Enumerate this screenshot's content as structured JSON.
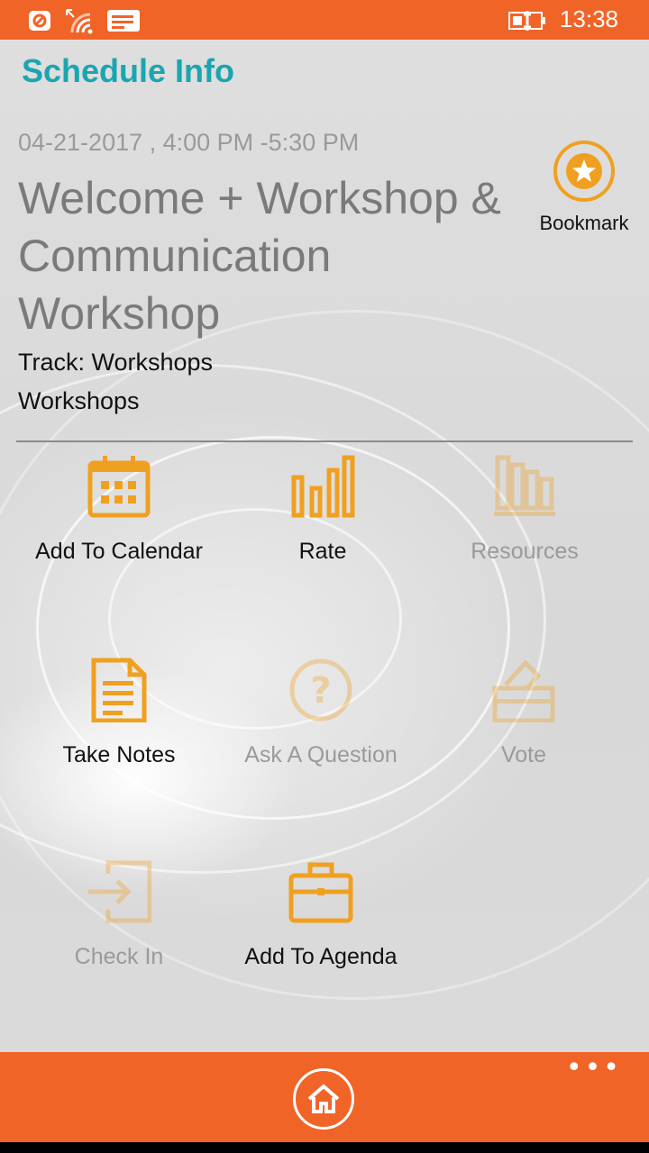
{
  "status_bar": {
    "time": "13:38"
  },
  "header": {
    "title": "Schedule Info"
  },
  "session": {
    "datetime": "04-21-2017 ,  4:00 PM -5:30 PM",
    "title": "Welcome + Workshop & Communication Workshop",
    "track": "Track: Workshops",
    "category": "Workshops"
  },
  "bookmark": {
    "label": "Bookmark",
    "icon": "star-circle-icon"
  },
  "colors": {
    "accent": "#f06428",
    "title": "#1aa6b0",
    "icon": "#f0a020"
  },
  "actions": [
    {
      "label": "Add To Calendar",
      "icon": "calendar-icon",
      "enabled": true
    },
    {
      "label": "Rate",
      "icon": "bar-chart-icon",
      "enabled": true
    },
    {
      "label": "Resources",
      "icon": "books-icon",
      "enabled": false
    },
    {
      "label": "Take Notes",
      "icon": "document-icon",
      "enabled": true
    },
    {
      "label": "Ask A Question",
      "icon": "question-icon",
      "enabled": false
    },
    {
      "label": "Vote",
      "icon": "ballot-icon",
      "enabled": false
    },
    {
      "label": "Check In",
      "icon": "sign-in-icon",
      "enabled": false
    },
    {
      "label": "Add To Agenda",
      "icon": "briefcase-icon",
      "enabled": true
    }
  ],
  "app_bar": {
    "home_icon": "home-icon",
    "more_icon": "more-icon"
  }
}
